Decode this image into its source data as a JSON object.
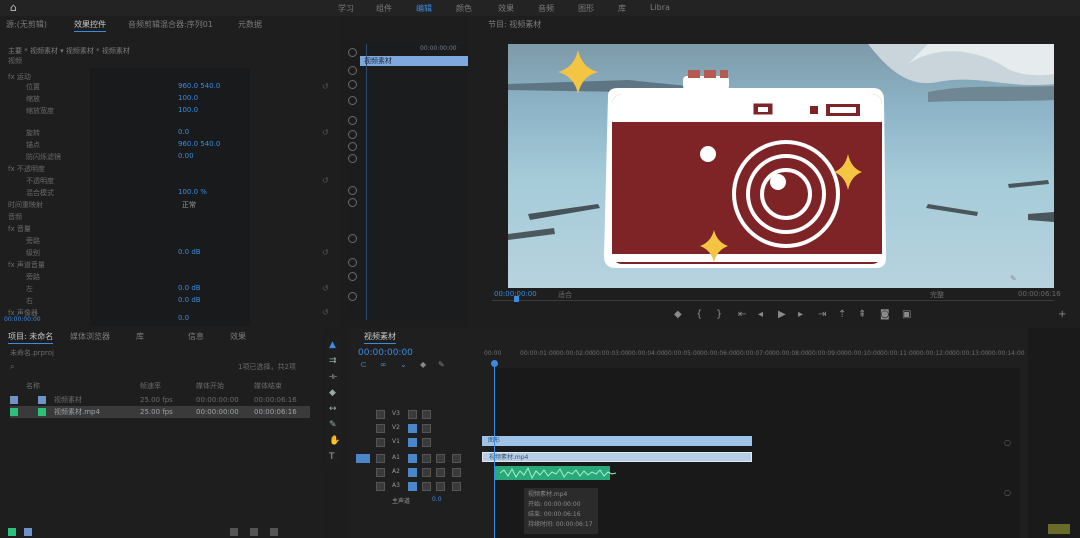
{
  "workspaces": [
    "学习",
    "组件",
    "编辑",
    "颜色",
    "效果",
    "音频",
    "图形",
    "库",
    "Libra"
  ],
  "effects_panel": {
    "tabs": [
      "源:(无剪辑)",
      "效果控件",
      "音频剪辑混合器:序列01",
      "元数据"
    ],
    "header": "主要 * 视频素材 ▾  视频素材 * 视频素材",
    "section": "视频",
    "rows": [
      "fx 运动",
      "位置",
      "缩放",
      "缩放宽度",
      "旋转",
      "锚点",
      "防闪烁滤镜",
      "fx 不透明度",
      "不透明度",
      "混合模式",
      "时间重映射",
      "音频",
      "fx 音量",
      "旁路",
      "级别",
      "fx 声道音量",
      "旁路",
      "左",
      "右",
      "fx 声像器"
    ],
    "values": [
      "960.0 540.0",
      "100.0",
      "100.0",
      "0.0",
      "960.0 540.0",
      "0.00",
      "100.0 %",
      "正常",
      "0.0 dB",
      "0.0 dB",
      "0.0 dB",
      "0.0"
    ],
    "timecode": "00:00:00:00"
  },
  "source_panel": {
    "timecode": "00:00:00:00",
    "selected_item": "视频素材"
  },
  "program_monitor": {
    "tab": "节目: 视频素材",
    "timecode_left": "00:00:00:00",
    "fit": "适合",
    "full": "完整",
    "timecode_right": "00:00:06:16"
  },
  "project_panel": {
    "tabs": [
      "项目: 未命名",
      "媒体浏览器",
      "库",
      "信息",
      "效果"
    ],
    "path": "未命名.prproj",
    "count": "1项已选择，共2项",
    "columns": [
      "名称",
      "帧速率",
      "媒体开始",
      "媒体结束"
    ],
    "rows": [
      {
        "name": "视频素材",
        "fps": "25.00 fps",
        "start": "00:00:00:00",
        "end": "00:00:06:16"
      },
      {
        "name": "视频素材.mp4",
        "fps": "25.00 fps",
        "start": "00:00:00:00",
        "end": "00:00:06:16"
      }
    ]
  },
  "timeline": {
    "tab": "视频素材",
    "timecode": "00:00:00:00",
    "ruler": [
      "00:00",
      "00:00:01:00",
      "00:00:02:00",
      "00:00:03:00",
      "00:00:04:00",
      "00:00:05:00",
      "00:00:06:00",
      "00:00:07:00",
      "00:00:08:00",
      "00:00:09:00",
      "00:00:10:00",
      "00:00:11:00",
      "00:00:12:00",
      "00:00:13:00",
      "00:00:14:00"
    ],
    "tracks": [
      "V3",
      "V2",
      "V1",
      "A1",
      "A2",
      "A3",
      "主声道"
    ],
    "clip_v1": "视频素材.mp4",
    "clip_v2": "图形",
    "clip_a1": "",
    "tooltip": [
      "视频素材.mp4",
      "开始: 00:00:00:00",
      "结束: 00:00:06:16",
      "持续时间: 00:00:06:17"
    ],
    "master_value": "0.0"
  },
  "colors": {
    "accent": "#3b8be0",
    "clip_video": "#9fc3e8",
    "clip_audio": "#2aa87a",
    "selection": "#7fa9de"
  }
}
